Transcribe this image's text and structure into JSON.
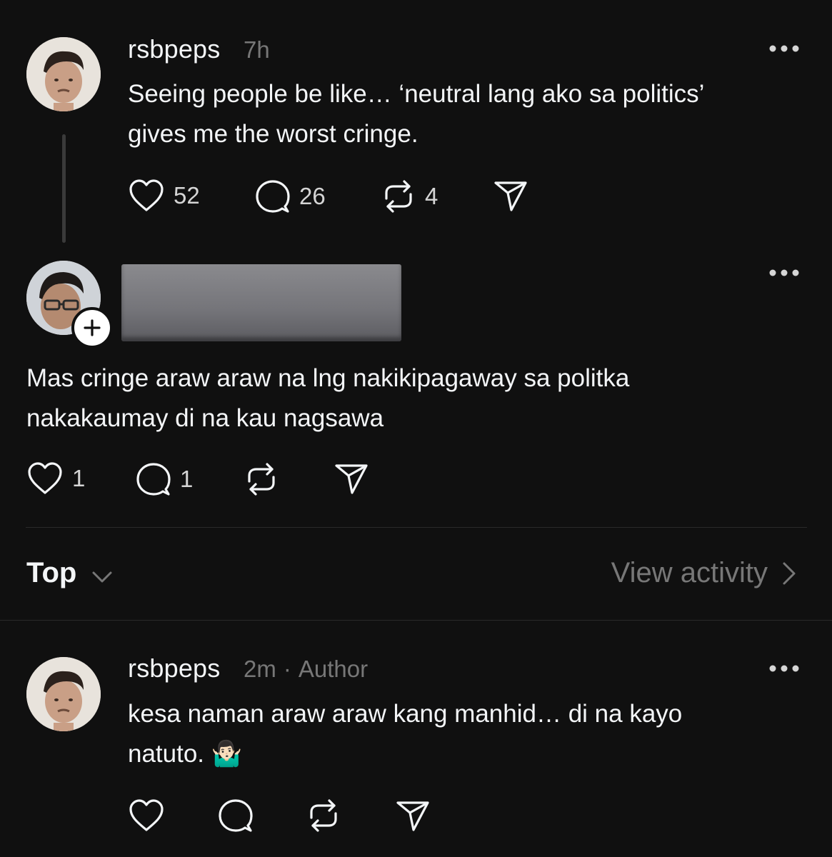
{
  "post": {
    "username": "rsbpeps",
    "time": "7h",
    "text": "Seeing people be like… ‘neutral lang ako sa politics’\ngives me the worst cringe.",
    "likes": "52",
    "replies": "26",
    "reposts": "4"
  },
  "reply": {
    "text": "Mas cringe araw araw na lng nakikipagaway sa politka\nnakakaumay di na kau nagsawa",
    "likes": "1",
    "replies": "1"
  },
  "sort_bar": {
    "sort_label": "Top",
    "view_activity_label": "View activity"
  },
  "author_reply": {
    "username": "rsbpeps",
    "time": "2m",
    "separator": "·",
    "author_badge": "Author",
    "text": "kesa naman araw araw kang manhid… di na kayo\nnatuto. 🤷🏻‍♂️"
  },
  "icons": {
    "like": "heart-icon",
    "reply": "comment-icon",
    "repost": "repost-icon",
    "share": "send-icon",
    "more": "more-icon",
    "follow": "plus-icon"
  },
  "colors": {
    "background": "#101010",
    "text": "#f3f5f7",
    "muted": "#777777"
  }
}
